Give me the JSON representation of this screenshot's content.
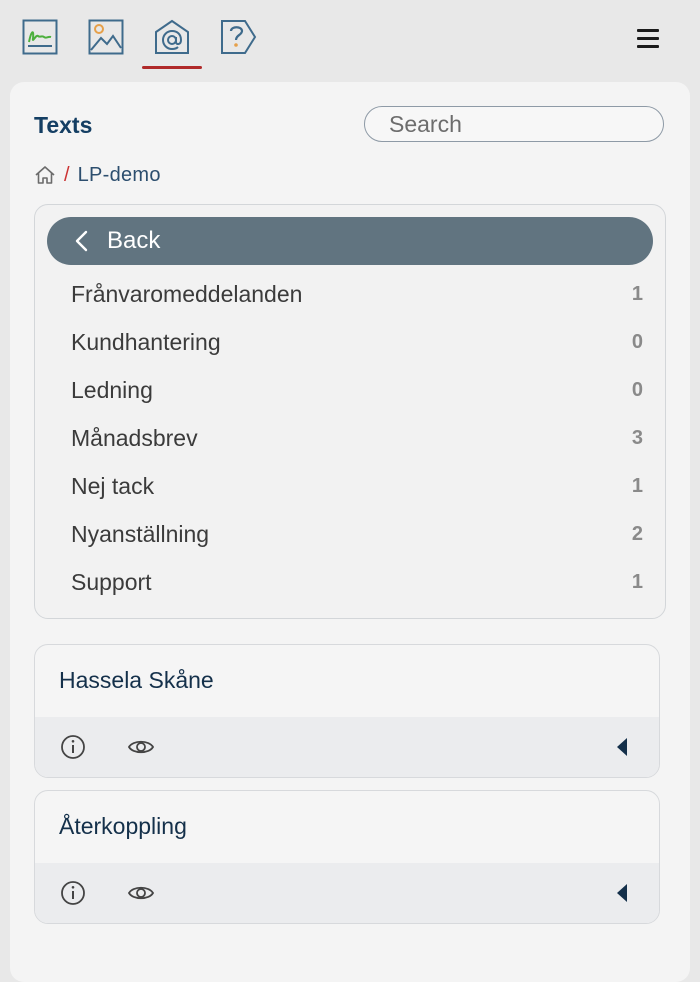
{
  "toolbar": {
    "icons": [
      "signature-icon",
      "image-icon",
      "at-sign-icon",
      "help-icon"
    ],
    "active_index": 2,
    "menu_icon": "hamburger-menu-icon"
  },
  "colors": {
    "title": "#143e63",
    "back_button_bg": "#617480",
    "active_underline": "#b02a2a",
    "signature_green": "#4caf3c"
  },
  "panel": {
    "title": "Texts",
    "search": {
      "placeholder": "Search",
      "value": ""
    }
  },
  "breadcrumb": {
    "home_icon": "home-icon",
    "separator": "/",
    "items": [
      "LP-demo"
    ]
  },
  "categories": {
    "back_label": "Back",
    "items": [
      {
        "name": "Frånvaromeddelanden",
        "count": "1"
      },
      {
        "name": "Kundhantering",
        "count": "0"
      },
      {
        "name": "Ledning",
        "count": "0"
      },
      {
        "name": "Månadsbrev",
        "count": "3"
      },
      {
        "name": "Nej tack",
        "count": "1"
      },
      {
        "name": "Nyanställning",
        "count": "2"
      },
      {
        "name": "Support",
        "count": "1"
      }
    ]
  },
  "cards": [
    {
      "title": "Hassela Skåne",
      "icons": [
        "info-icon",
        "eye-icon",
        "expand-arrow-icon"
      ]
    },
    {
      "title": "Återkoppling",
      "icons": [
        "info-icon",
        "eye-icon",
        "expand-arrow-icon"
      ]
    }
  ]
}
